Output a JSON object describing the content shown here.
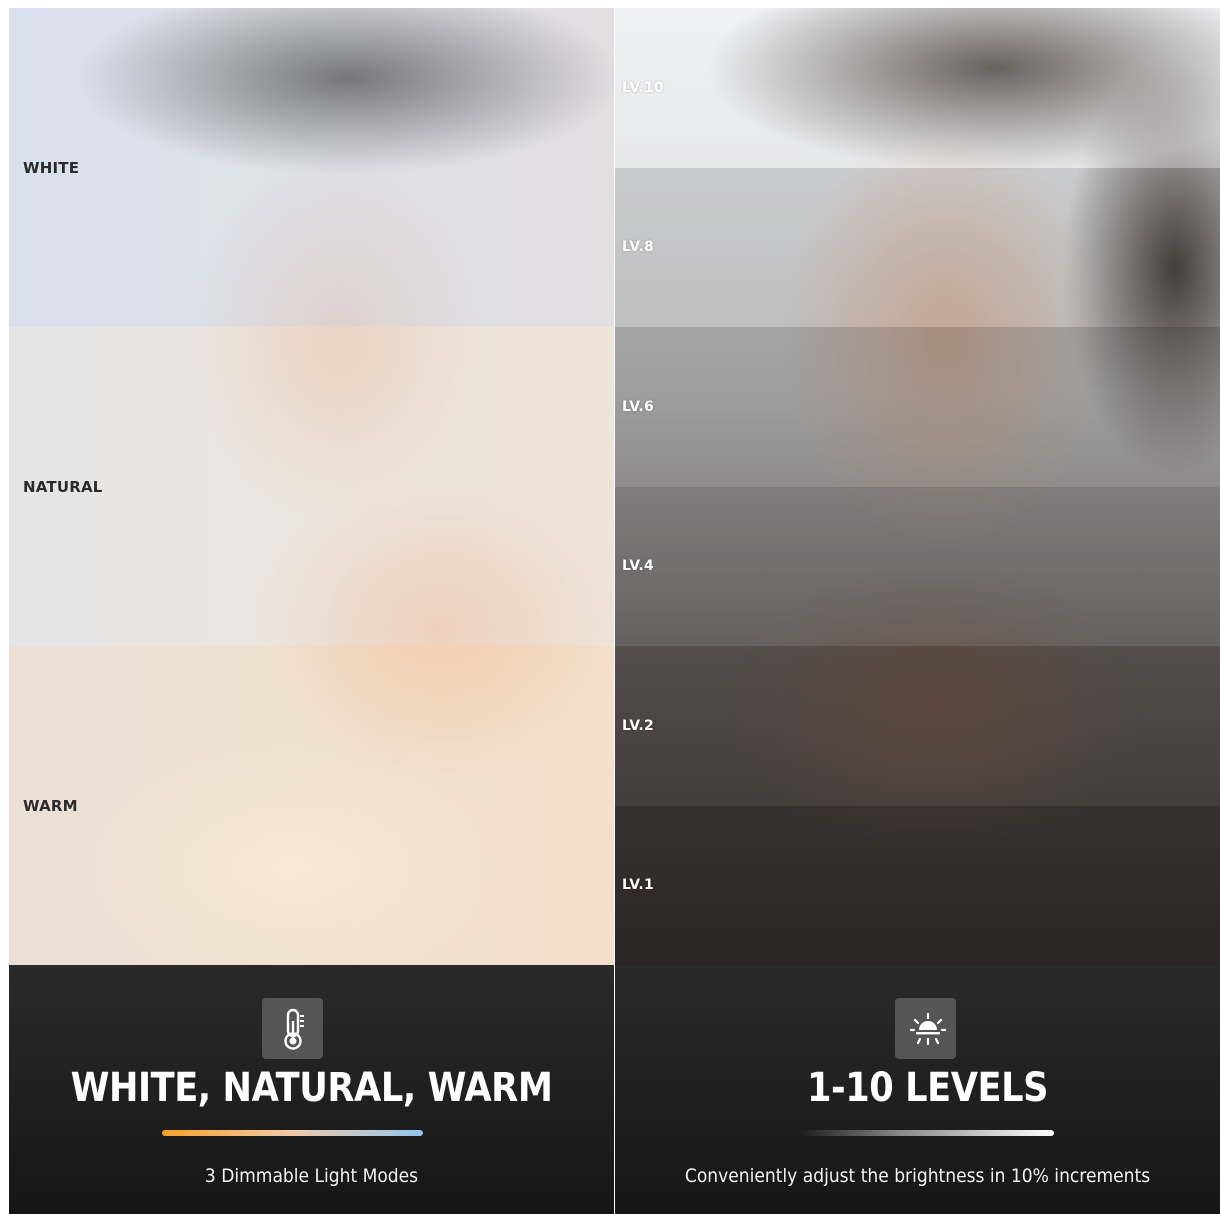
{
  "left_panel": {
    "bands": [
      {
        "label": "WHITE",
        "tint": "rgba(210,222,245,0.45)"
      },
      {
        "label": "NATURAL",
        "tint": "rgba(240,236,228,0.35)"
      },
      {
        "label": "WARM",
        "tint": "rgba(250,222,190,0.40)"
      }
    ],
    "icon": "thermometer-icon",
    "title": "WHITE, NATURAL, WARM",
    "subtitle": "3 Dimmable Light Modes"
  },
  "right_panel": {
    "bands": [
      {
        "label": "LV.10",
        "tint": "rgba(255,255,255,0.30)"
      },
      {
        "label": "LV.8",
        "tint": "rgba(120,120,120,0.18)"
      },
      {
        "label": "LV.6",
        "tint": "rgba(70,70,70,0.32)"
      },
      {
        "label": "LV.4",
        "tint": "rgba(60,60,60,0.42)"
      },
      {
        "label": "LV.2",
        "tint": "rgba(40,36,34,0.52)"
      },
      {
        "label": "LV.1",
        "tint": "rgba(30,26,24,0.62)"
      }
    ],
    "icon": "brightness-icon",
    "title": "1-10 LEVELS",
    "subtitle": "Conveniently adjust the brightness in 10% increments"
  }
}
